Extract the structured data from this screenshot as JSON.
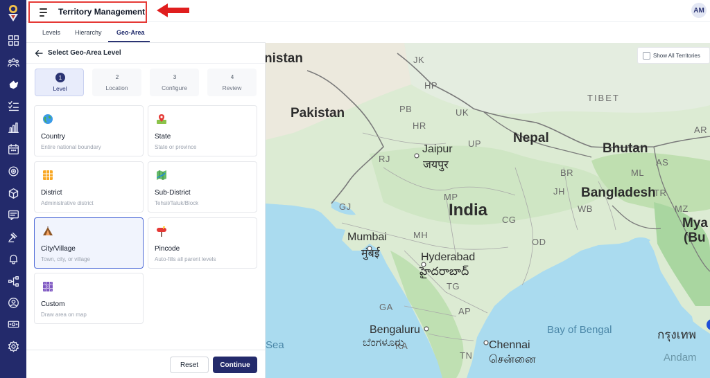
{
  "app": {
    "title": "Territory Management",
    "avatar_initials": "AM"
  },
  "tabs": [
    {
      "label": "Levels"
    },
    {
      "label": "Hierarchy"
    },
    {
      "label": "Geo-Area",
      "active": true
    }
  ],
  "panel": {
    "title": "Select Geo-Area Level",
    "steps": [
      {
        "num": "1",
        "label": "Level",
        "active": true
      },
      {
        "num": "2",
        "label": "Location"
      },
      {
        "num": "3",
        "label": "Configure"
      },
      {
        "num": "4",
        "label": "Review"
      }
    ],
    "levels": [
      {
        "title": "Country",
        "subtitle": "Entire national boundary",
        "icon": "globe-icon"
      },
      {
        "title": "State",
        "subtitle": "State or province",
        "icon": "map-pin-icon"
      },
      {
        "title": "District",
        "subtitle": "Administrative district",
        "icon": "grid-icon"
      },
      {
        "title": "Sub-District",
        "subtitle": "Tehsil/Taluk/Block",
        "icon": "map-icon"
      },
      {
        "title": "City/Village",
        "subtitle": "Town, city, or village",
        "icon": "tent-icon",
        "selected": true
      },
      {
        "title": "Pincode",
        "subtitle": "Auto-fills all parent levels",
        "icon": "mailbox-icon"
      },
      {
        "title": "Custom",
        "subtitle": "Draw area on map",
        "icon": "custom-grid-icon"
      }
    ],
    "reset_label": "Reset",
    "continue_label": "Continue"
  },
  "map": {
    "show_all_label": "Show All Territories",
    "show_all_checked": false,
    "labels": {
      "pakistan_partial": "nistan",
      "pakistan": "Pakistan",
      "nepal": "Nepal",
      "bhutan": "Bhutan",
      "bangladesh": "Bangladesh",
      "india": "India",
      "myanmar_partial": "Mya",
      "myanmar_partial_2": "(Bu",
      "tibet": "TIBET",
      "jaipur": "Jaipur",
      "jaipur_hi": "जयपुर",
      "mumbai": "Mumbai",
      "mumbai_mr": "मुंबई",
      "hyderabad": "Hyderabad",
      "hyderabad_te": "హైదరాబాద్",
      "bengaluru": "Bengaluru",
      "bengaluru_kn": "ಬೆಂಗಳೂರು",
      "chennai": "Chennai",
      "chennai_ta": "சென்னை",
      "bay_of_bengal": "Bay of Bengal",
      "sea": "Sea",
      "thai_partial": "กรุงเทพ",
      "andaman_partial": "Andam",
      "jk": "JK",
      "hp": "HP",
      "pb": "PB",
      "uk": "UK",
      "hr": "HR",
      "rj": "RJ",
      "up": "UP",
      "br": "BR",
      "ml": "ML",
      "as": "AS",
      "jh": "JH",
      "wb": "WB",
      "mp": "MP",
      "gj": "GJ",
      "cg": "CG",
      "od": "OD",
      "mh": "MH",
      "tg": "TG",
      "ga": "GA",
      "ap": "AP",
      "ka": "KA",
      "tn": "TN",
      "ar": "AR",
      "tr": "TR",
      "mz": "MZ"
    }
  }
}
